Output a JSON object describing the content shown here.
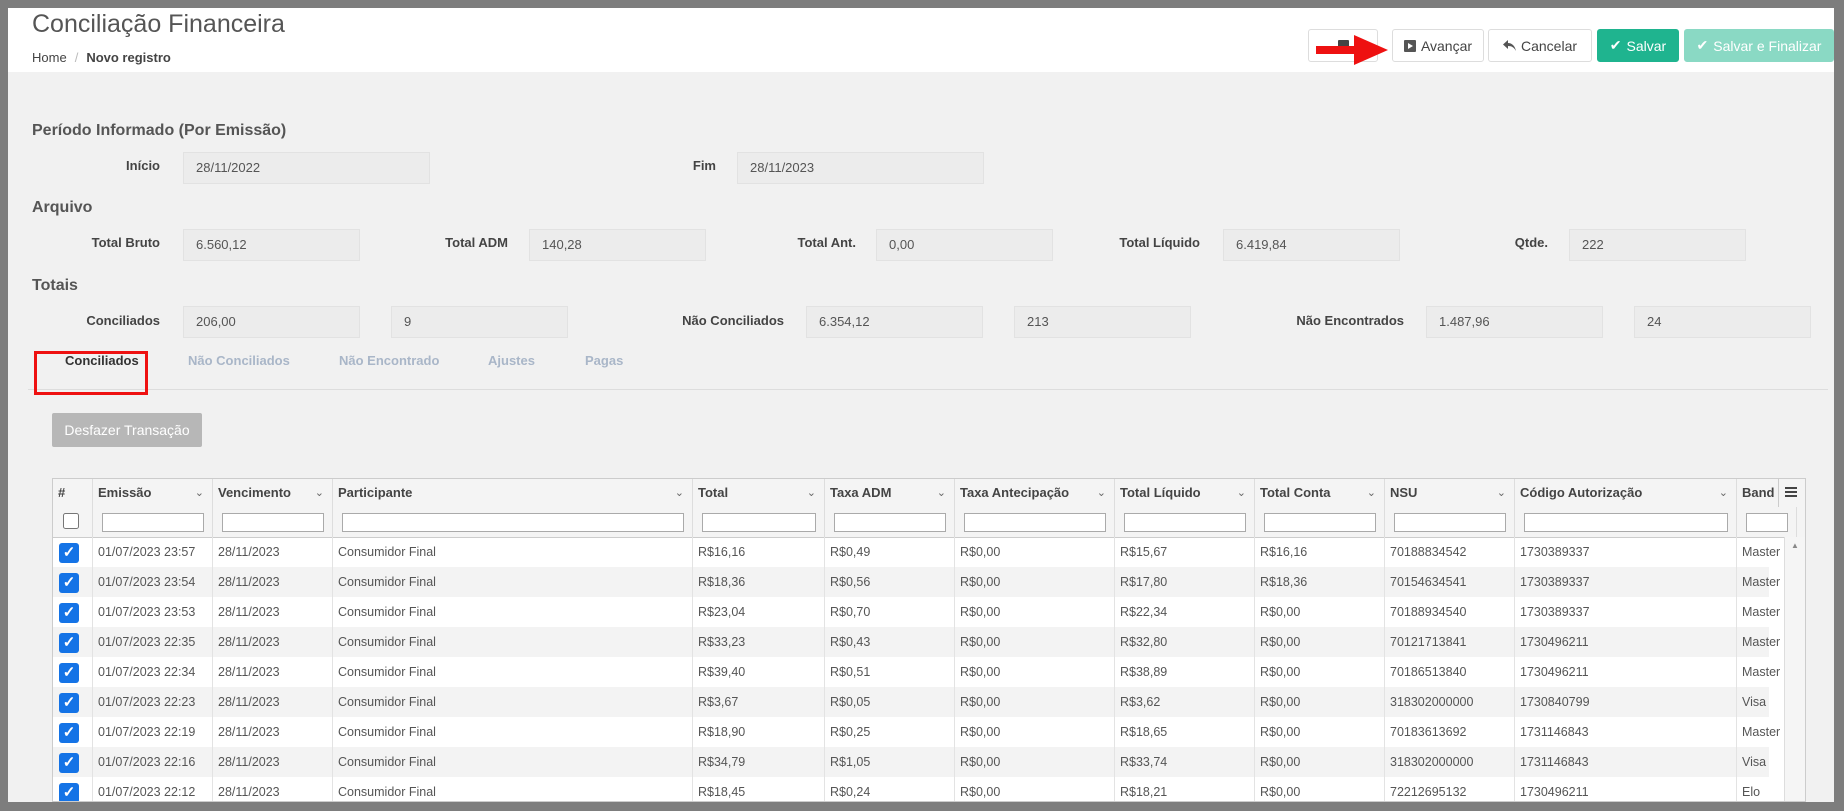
{
  "header": {
    "title": "Conciliação Financeira",
    "breadcrumb": {
      "home": "Home",
      "current": "Novo registro"
    },
    "buttons": {
      "avancar": "Avançar",
      "cancelar": "Cancelar",
      "salvar": "Salvar",
      "salvar_finalizar": "Salvar e Finalizar"
    }
  },
  "periodo": {
    "title": "Período Informado (Por Emissão)",
    "inicio_label": "Início",
    "inicio_value": "28/11/2022",
    "fim_label": "Fim",
    "fim_value": "28/11/2023"
  },
  "arquivo": {
    "title": "Arquivo",
    "total_bruto_label": "Total Bruto",
    "total_bruto": "6.560,12",
    "total_adm_label": "Total ADM",
    "total_adm": "140,28",
    "total_ant_label": "Total Ant.",
    "total_ant": "0,00",
    "total_liquido_label": "Total Líquido",
    "total_liquido": "6.419,84",
    "qtde_label": "Qtde.",
    "qtde": "222"
  },
  "totais": {
    "title": "Totais",
    "conciliados_label": "Conciliados",
    "conciliados_valor": "206,00",
    "conciliados_qtde": "9",
    "nao_conciliados_label": "Não Conciliados",
    "nao_conciliados_valor": "6.354,12",
    "nao_conciliados_qtde": "213",
    "nao_encontrados_label": "Não Encontrados",
    "nao_encontrados_valor": "1.487,96",
    "nao_encontrados_qtde": "24"
  },
  "tabs": [
    "Conciliados",
    "Não Conciliados",
    "Não Encontrado",
    "Ajustes",
    "Pagas"
  ],
  "undo_button": "Desfazer Transação",
  "grid": {
    "columns": [
      "#",
      "Emissão",
      "Vencimento",
      "Participante",
      "Total",
      "Taxa ADM",
      "Taxa Antecipação",
      "Total Líquido",
      "Total Conta",
      "NSU",
      "Código Autorização",
      "Band"
    ],
    "rows": [
      [
        "01/07/2023 23:57",
        "28/11/2023",
        "Consumidor Final",
        "R$16,16",
        "R$0,49",
        "R$0,00",
        "R$15,67",
        "R$16,16",
        "70188834542",
        "1730389337",
        "Master"
      ],
      [
        "01/07/2023 23:54",
        "28/11/2023",
        "Consumidor Final",
        "R$18,36",
        "R$0,56",
        "R$0,00",
        "R$17,80",
        "R$18,36",
        "70154634541",
        "1730389337",
        "Master"
      ],
      [
        "01/07/2023 23:53",
        "28/11/2023",
        "Consumidor Final",
        "R$23,04",
        "R$0,70",
        "R$0,00",
        "R$22,34",
        "R$0,00",
        "70188934540",
        "1730389337",
        "Master"
      ],
      [
        "01/07/2023 22:35",
        "28/11/2023",
        "Consumidor Final",
        "R$33,23",
        "R$0,43",
        "R$0,00",
        "R$32,80",
        "R$0,00",
        "70121713841",
        "1730496211",
        "Master"
      ],
      [
        "01/07/2023 22:34",
        "28/11/2023",
        "Consumidor Final",
        "R$39,40",
        "R$0,51",
        "R$0,00",
        "R$38,89",
        "R$0,00",
        "70186513840",
        "1730496211",
        "Master"
      ],
      [
        "01/07/2023 22:23",
        "28/11/2023",
        "Consumidor Final",
        "R$3,67",
        "R$0,05",
        "R$0,00",
        "R$3,62",
        "R$0,00",
        "318302000000",
        "1730840799",
        "Visa"
      ],
      [
        "01/07/2023 22:19",
        "28/11/2023",
        "Consumidor Final",
        "R$18,90",
        "R$0,25",
        "R$0,00",
        "R$18,65",
        "R$0,00",
        "70183613692",
        "1731146843",
        "Master"
      ],
      [
        "01/07/2023 22:16",
        "28/11/2023",
        "Consumidor Final",
        "R$34,79",
        "R$1,05",
        "R$0,00",
        "R$33,74",
        "R$0,00",
        "318302000000",
        "1731146843",
        "Visa"
      ],
      [
        "01/07/2023 22:12",
        "28/11/2023",
        "Consumidor Final",
        "R$18,45",
        "R$0,24",
        "R$0,00",
        "R$18,21",
        "R$0,00",
        "72212695132",
        "1730496211",
        "Elo"
      ]
    ]
  },
  "colors": {
    "accent": "#1fb48f",
    "checkbox": "#1473e6",
    "highlight": "#e11111"
  }
}
